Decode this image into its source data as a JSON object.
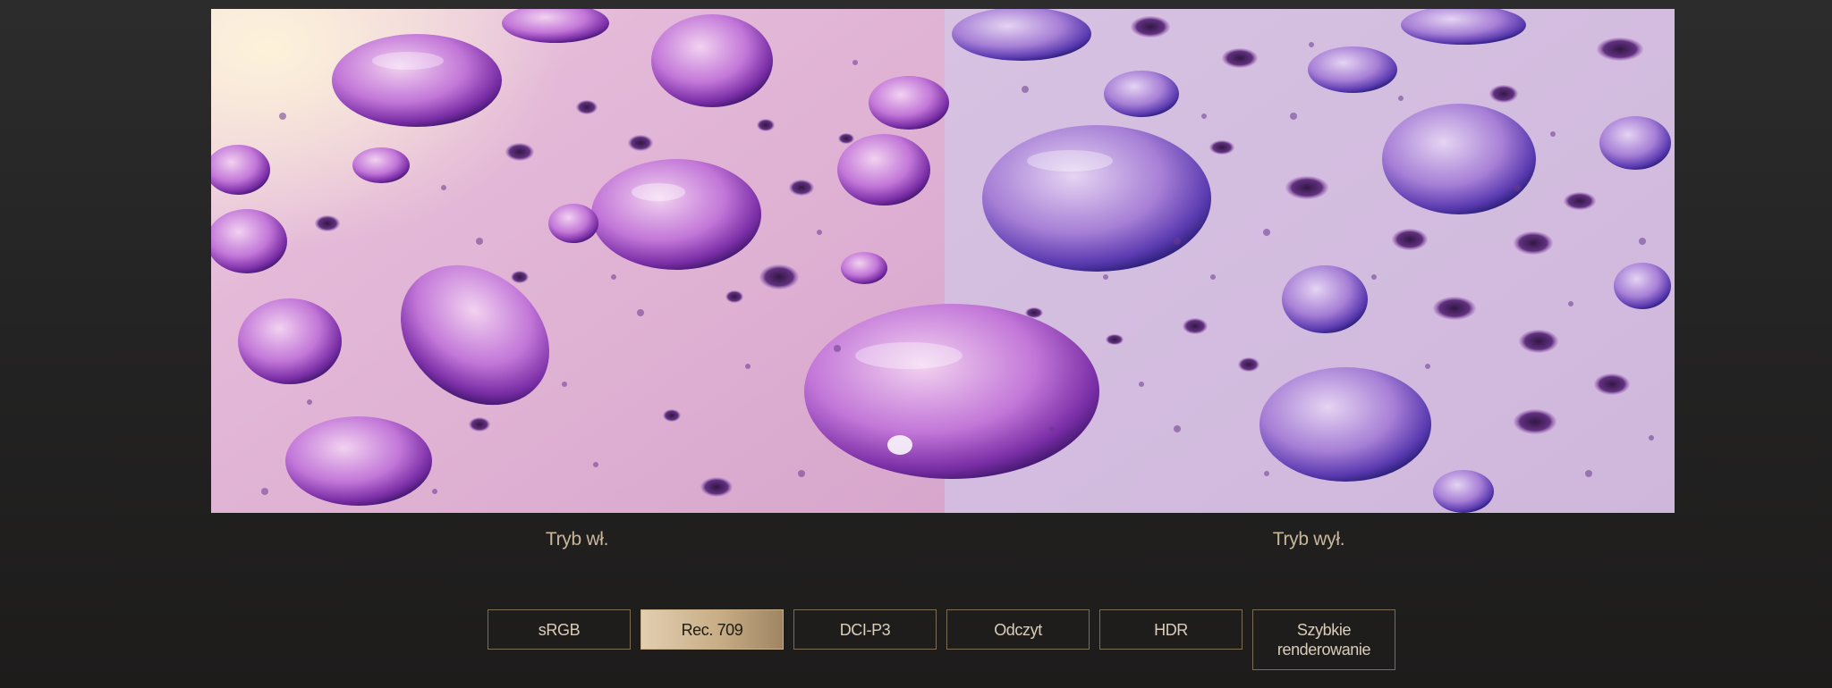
{
  "comparison": {
    "left_label": "Tryb wł.",
    "right_label": "Tryb wył."
  },
  "color_modes": [
    {
      "label": "sRGB",
      "active": false
    },
    {
      "label": "Rec. 709",
      "active": true
    },
    {
      "label": "DCI-P3",
      "active": false
    },
    {
      "label": "Odczyt",
      "active": false
    },
    {
      "label": "HDR",
      "active": false
    },
    {
      "label": "Szybkie renderowanie",
      "active": false
    }
  ],
  "colors": {
    "accent_gold": "#c8ad85",
    "label_text": "#c9b79b",
    "button_border": "#7e6d55"
  }
}
